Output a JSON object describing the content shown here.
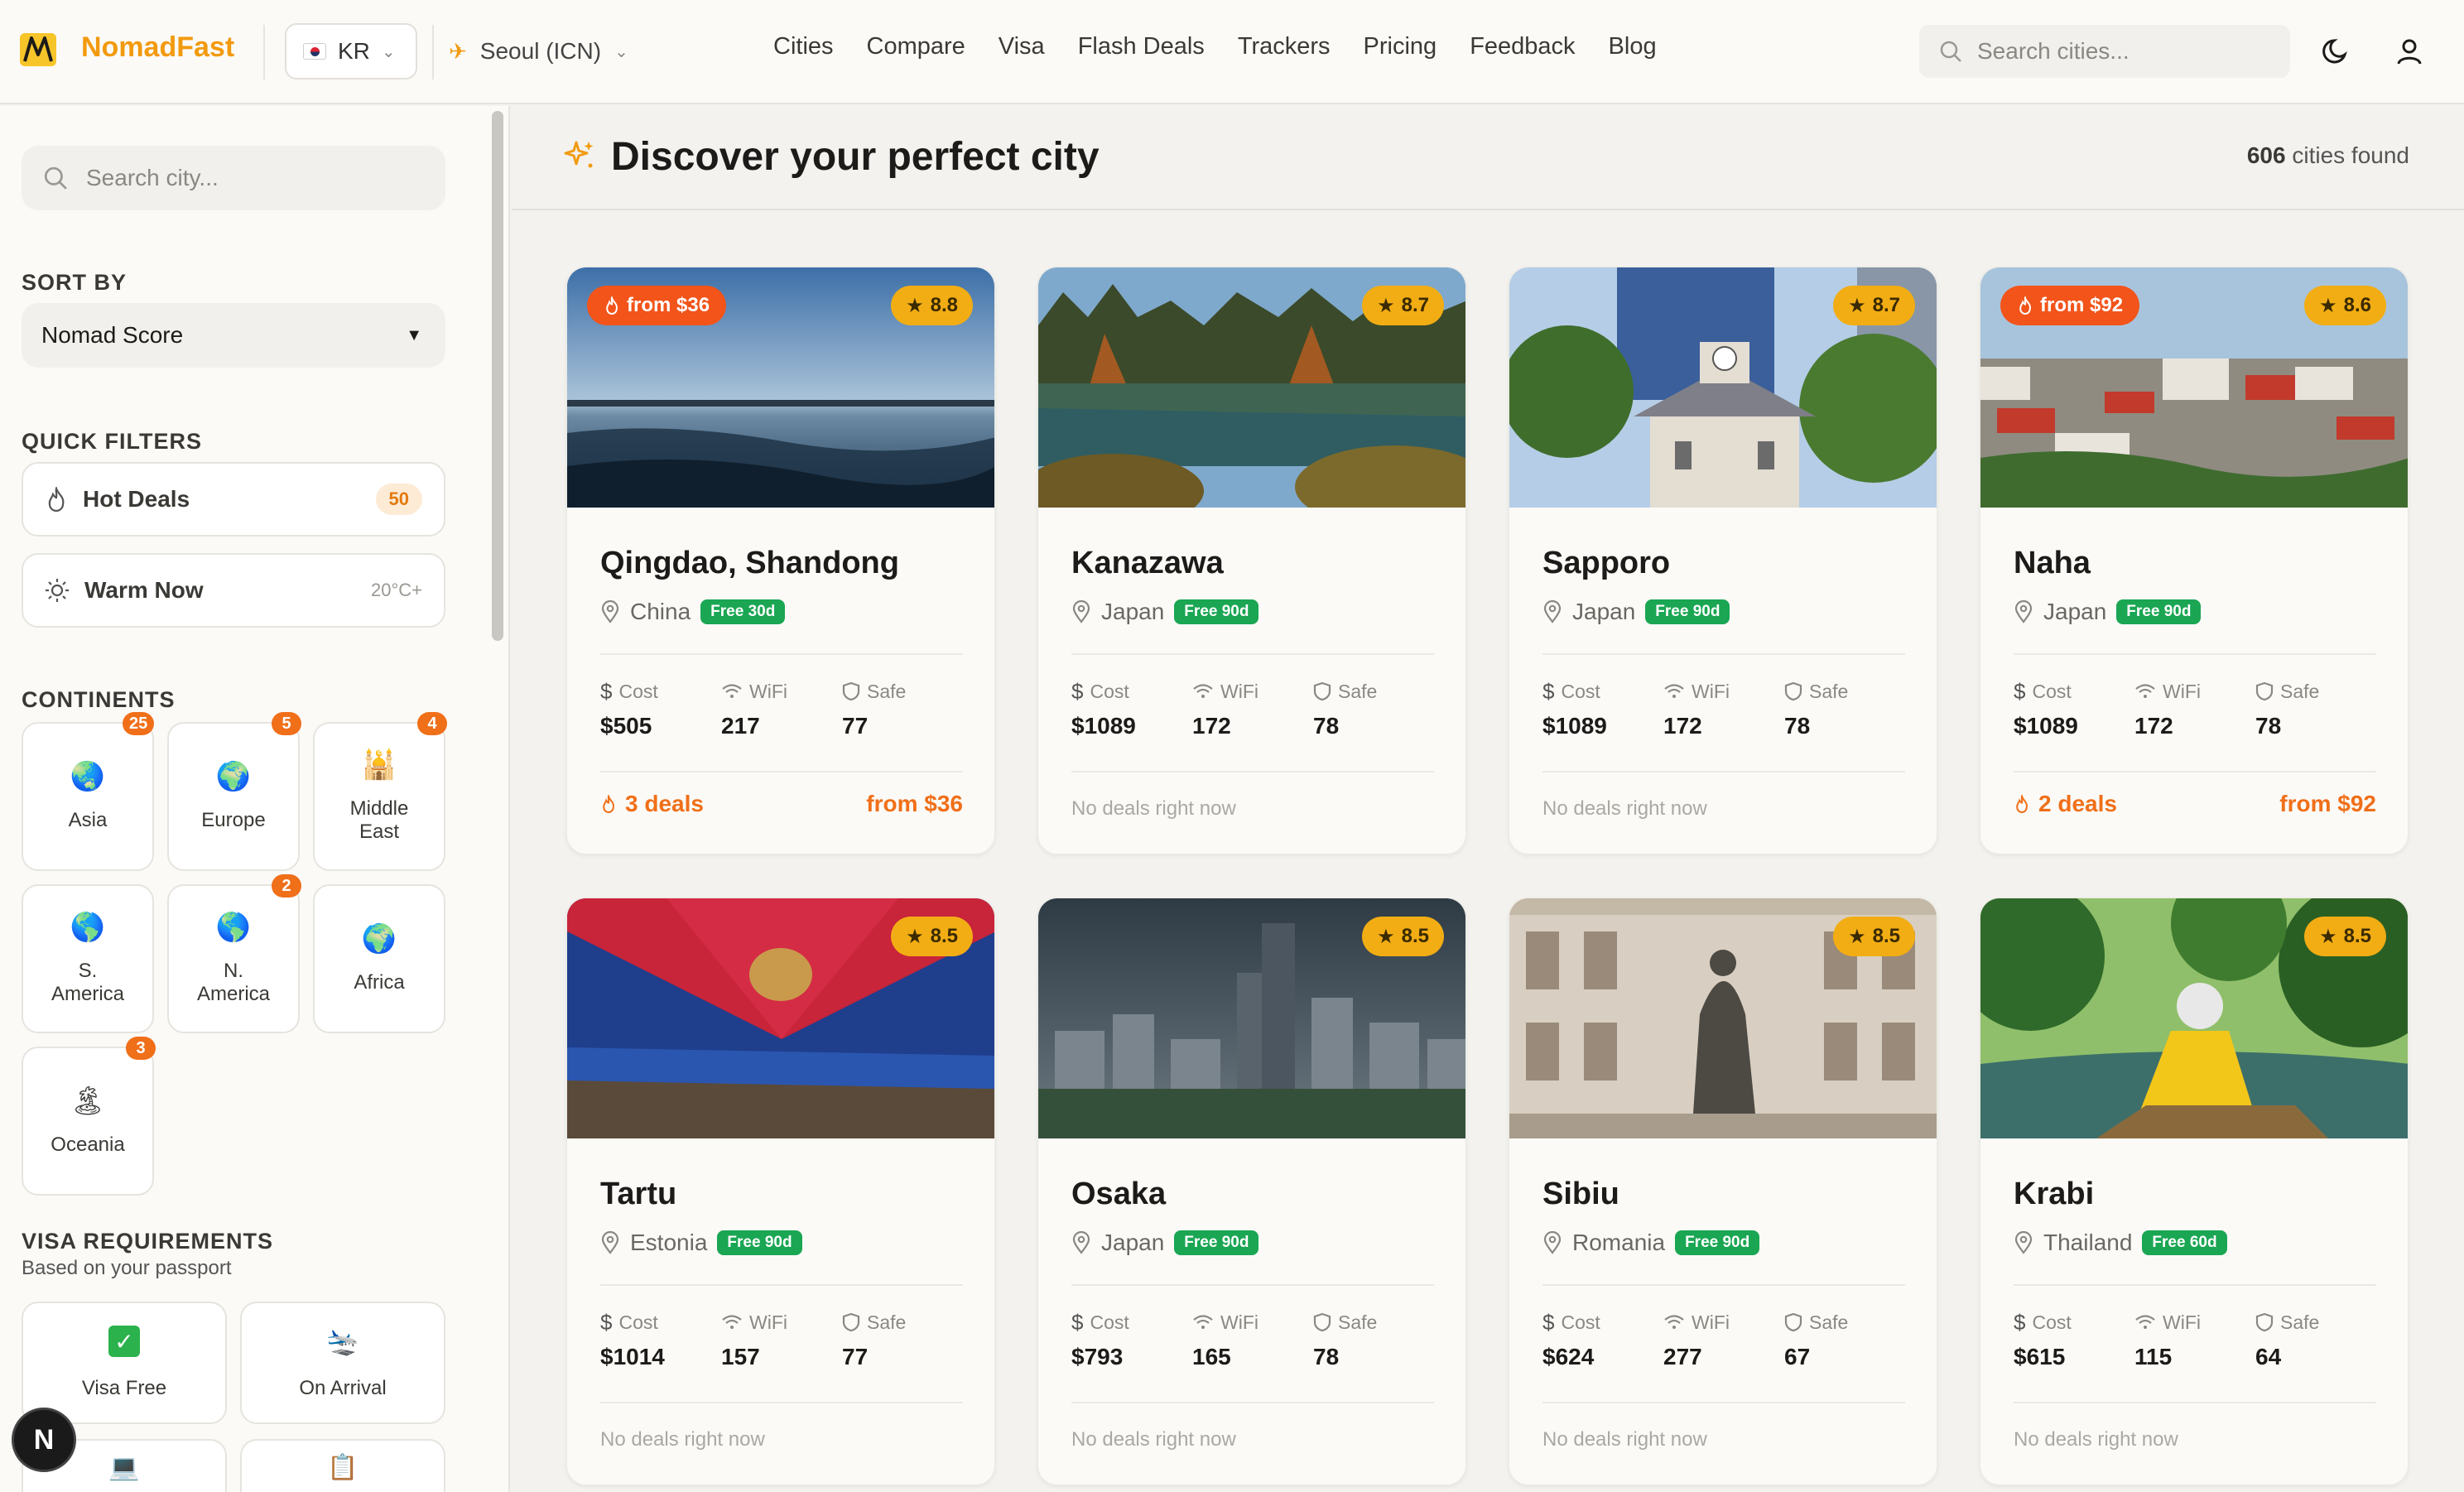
{
  "header": {
    "brand": "NomadFast",
    "country": "KR",
    "airport": "Seoul (ICN)",
    "nav": [
      "Cities",
      "Compare",
      "Visa",
      "Flash Deals",
      "Trackers",
      "Pricing",
      "Feedback",
      "Blog"
    ],
    "search_placeholder": "Search cities..."
  },
  "sidebar": {
    "search_placeholder": "Search city...",
    "sort_heading": "SORT BY",
    "sort_value": "Nomad Score",
    "quick_heading": "QUICK FILTERS",
    "quick_filters": [
      {
        "label": "Hot Deals",
        "badge": "50",
        "icon": "flame-icon"
      },
      {
        "label": "Warm Now",
        "hint": "20°C+",
        "icon": "sun-icon"
      }
    ],
    "continents_heading": "CONTINENTS",
    "continents": [
      {
        "label": "Asia",
        "badge": "25",
        "icon": "globe-icon"
      },
      {
        "label": "Europe",
        "badge": "5",
        "icon": "globe-icon"
      },
      {
        "label": "Middle East",
        "badge": "4",
        "icon": "mosque-icon"
      },
      {
        "label": "S. America",
        "badge": "",
        "icon": "globe-icon"
      },
      {
        "label": "N. America",
        "badge": "2",
        "icon": "globe-icon"
      },
      {
        "label": "Africa",
        "badge": "",
        "icon": "globe-icon"
      },
      {
        "label": "Oceania",
        "badge": "3",
        "icon": "island-icon"
      }
    ],
    "visa_heading": "VISA REQUIREMENTS",
    "visa_sub": "Based on your passport",
    "visa_options": [
      {
        "label": "Visa Free",
        "icon": "check-icon"
      },
      {
        "label": "On Arrival",
        "icon": "plane-arrival-icon"
      }
    ]
  },
  "main": {
    "title": "Discover your perfect city",
    "found_count": "606",
    "found_suffix": "cities found",
    "stat_labels": {
      "cost": "Cost",
      "wifi": "WiFi",
      "safe": "Safe"
    },
    "no_deals": "No deals right now",
    "cards": [
      {
        "city": "Qingdao, Shandong",
        "country": "China",
        "visa": "Free 30d",
        "score": "8.8",
        "deal_badge": "from $36",
        "cost": "$505",
        "wifi": "217",
        "safe": "77",
        "deals": "3 deals",
        "deals_from": "from $36"
      },
      {
        "city": "Kanazawa",
        "country": "Japan",
        "visa": "Free 90d",
        "score": "8.7",
        "deal_badge": "",
        "cost": "$1089",
        "wifi": "172",
        "safe": "78",
        "deals": "",
        "deals_from": ""
      },
      {
        "city": "Sapporo",
        "country": "Japan",
        "visa": "Free 90d",
        "score": "8.7",
        "deal_badge": "",
        "cost": "$1089",
        "wifi": "172",
        "safe": "78",
        "deals": "",
        "deals_from": ""
      },
      {
        "city": "Naha",
        "country": "Japan",
        "visa": "Free 90d",
        "score": "8.6",
        "deal_badge": "from $92",
        "cost": "$1089",
        "wifi": "172",
        "safe": "78",
        "deals": "2 deals",
        "deals_from": "from $92"
      },
      {
        "city": "Tartu",
        "country": "Estonia",
        "visa": "Free 90d",
        "score": "8.5",
        "deal_badge": "",
        "cost": "$1014",
        "wifi": "157",
        "safe": "77",
        "deals": "",
        "deals_from": ""
      },
      {
        "city": "Osaka",
        "country": "Japan",
        "visa": "Free 90d",
        "score": "8.5",
        "deal_badge": "",
        "cost": "$793",
        "wifi": "165",
        "safe": "78",
        "deals": "",
        "deals_from": ""
      },
      {
        "city": "Sibiu",
        "country": "Romania",
        "visa": "Free 90d",
        "score": "8.5",
        "deal_badge": "",
        "cost": "$624",
        "wifi": "277",
        "safe": "67",
        "deals": "",
        "deals_from": ""
      },
      {
        "city": "Krabi",
        "country": "Thailand",
        "visa": "Free 60d",
        "score": "8.5",
        "deal_badge": "",
        "cost": "$615",
        "wifi": "115",
        "safe": "64",
        "deals": "",
        "deals_from": ""
      }
    ]
  },
  "dev_badge": "N",
  "colors": {
    "accent": "#f29a0f",
    "deal": "#f2541a",
    "visa_free": "#1aa653",
    "score": "#f2ad14"
  }
}
